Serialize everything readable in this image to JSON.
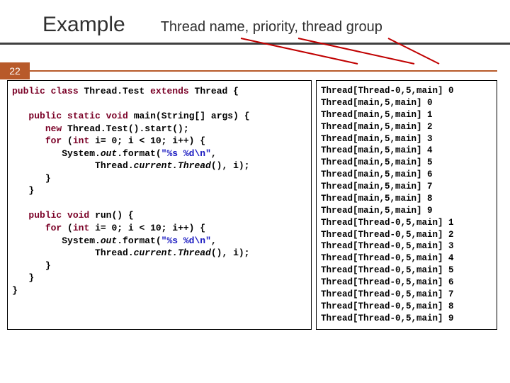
{
  "header": {
    "title": "Example",
    "subtitle": "Thread name, priority, thread group"
  },
  "page_number": "22",
  "code_left": {
    "l1a": "public",
    "l1b": "class",
    "l1c": "Thread.Test",
    "l1d": "extends",
    "l1e": "Thread {",
    "l2a": "public",
    "l2b": "static",
    "l2c": "void",
    "l2d": "main(String[] args) {",
    "l3a": "new",
    "l3b": "Thread.Test().start();",
    "l4a": "for",
    "l4b": "(",
    "l4c": "int",
    "l4d": "i= 0; i < 10; i++) {",
    "l5a": "System.",
    "l5b": "out",
    "l5c": ".format(",
    "l5d": "\"%s %d\\n\"",
    "l5e": ",",
    "l6a": "Thread.",
    "l6b": "current.Thread",
    "l6c": "(), i);",
    "l7": "}",
    "l8": "}",
    "l9a": "public",
    "l9b": "void",
    "l9c": "run() {",
    "l10a": "for",
    "l10b": "(",
    "l10c": "int",
    "l10d": "i= 0; i < 10; i++) {",
    "l11a": "System.",
    "l11b": "out",
    "l11c": ".format(",
    "l11d": "\"%s %d\\n\"",
    "l11e": ",",
    "l12a": "Thread.",
    "l12b": "current.Thread",
    "l12c": "(), i);",
    "l13": "}",
    "l14": "}",
    "l15": "}"
  },
  "output_lines": [
    "Thread[Thread-0,5,main] 0",
    "Thread[main,5,main] 0",
    "Thread[main,5,main] 1",
    "Thread[main,5,main] 2",
    "Thread[main,5,main] 3",
    "Thread[main,5,main] 4",
    "Thread[main,5,main] 5",
    "Thread[main,5,main] 6",
    "Thread[main,5,main] 7",
    "Thread[main,5,main] 8",
    "Thread[main,5,main] 9",
    "Thread[Thread-0,5,main] 1",
    "Thread[Thread-0,5,main] 2",
    "Thread[Thread-0,5,main] 3",
    "Thread[Thread-0,5,main] 4",
    "Thread[Thread-0,5,main] 5",
    "Thread[Thread-0,5,main] 6",
    "Thread[Thread-0,5,main] 7",
    "Thread[Thread-0,5,main] 8",
    "Thread[Thread-0,5,main] 9"
  ]
}
